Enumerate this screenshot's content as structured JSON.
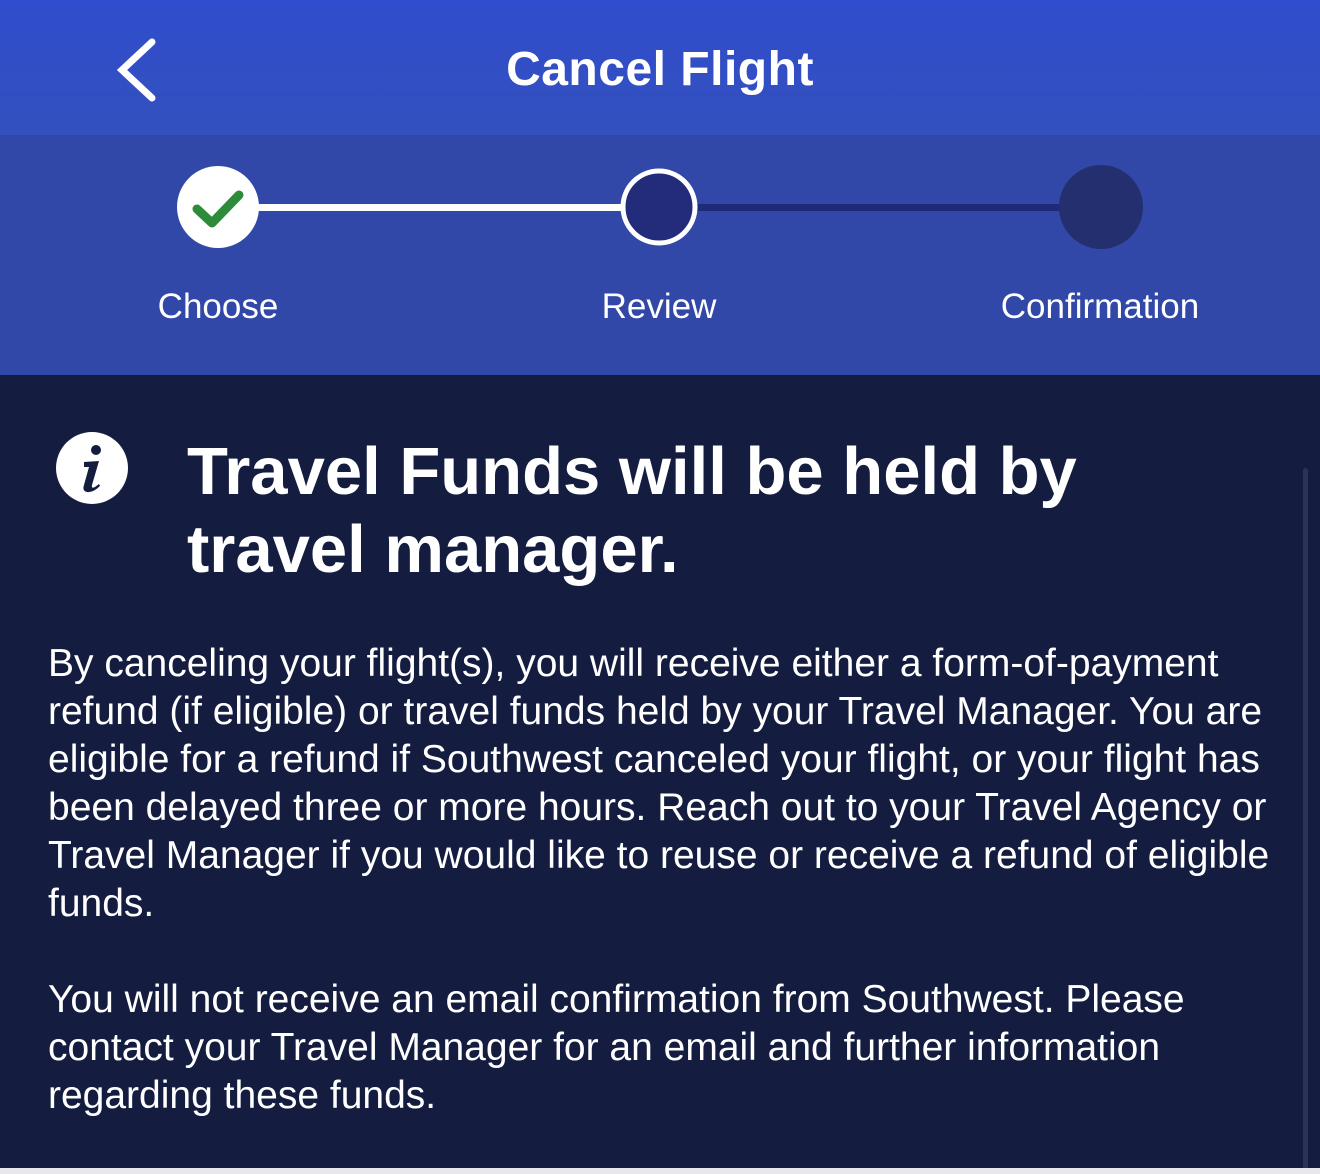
{
  "header": {
    "title": "Cancel Flight",
    "back_icon": "chevron-left-icon"
  },
  "stepper": {
    "steps": [
      {
        "label": "Choose",
        "state": "completed",
        "icon": "check-icon"
      },
      {
        "label": "Review",
        "state": "current"
      },
      {
        "label": "Confirmation",
        "state": "upcoming"
      }
    ],
    "colors": {
      "completed_check": "#2e8b3a",
      "current_fill": "#222c7a",
      "upcoming_fill": "#232f6e",
      "line_done": "#ffffff",
      "line_pending": "#1f2a78"
    }
  },
  "notice": {
    "icon": "info-icon",
    "heading": "Travel Funds will be held by travel manager.",
    "paragraphs": [
      "By canceling your flight(s), you will receive either a form-of-payment refund (if eligible) or travel funds held by your Travel Manager. You are eligible for a refund if Southwest canceled your flight, or your flight has been delayed three or more hours. Reach out to your Travel Agency or Travel Manager if you would like to reuse or receive a refund of eligible funds.",
      "You will not receive an email confirmation from Southwest. Please contact your Travel Manager for an email and further information regarding these funds."
    ]
  },
  "colors": {
    "header_bg": "#3050c8",
    "stepper_bg": "#3148a8",
    "content_bg": "#141c40",
    "text": "#ffffff"
  }
}
